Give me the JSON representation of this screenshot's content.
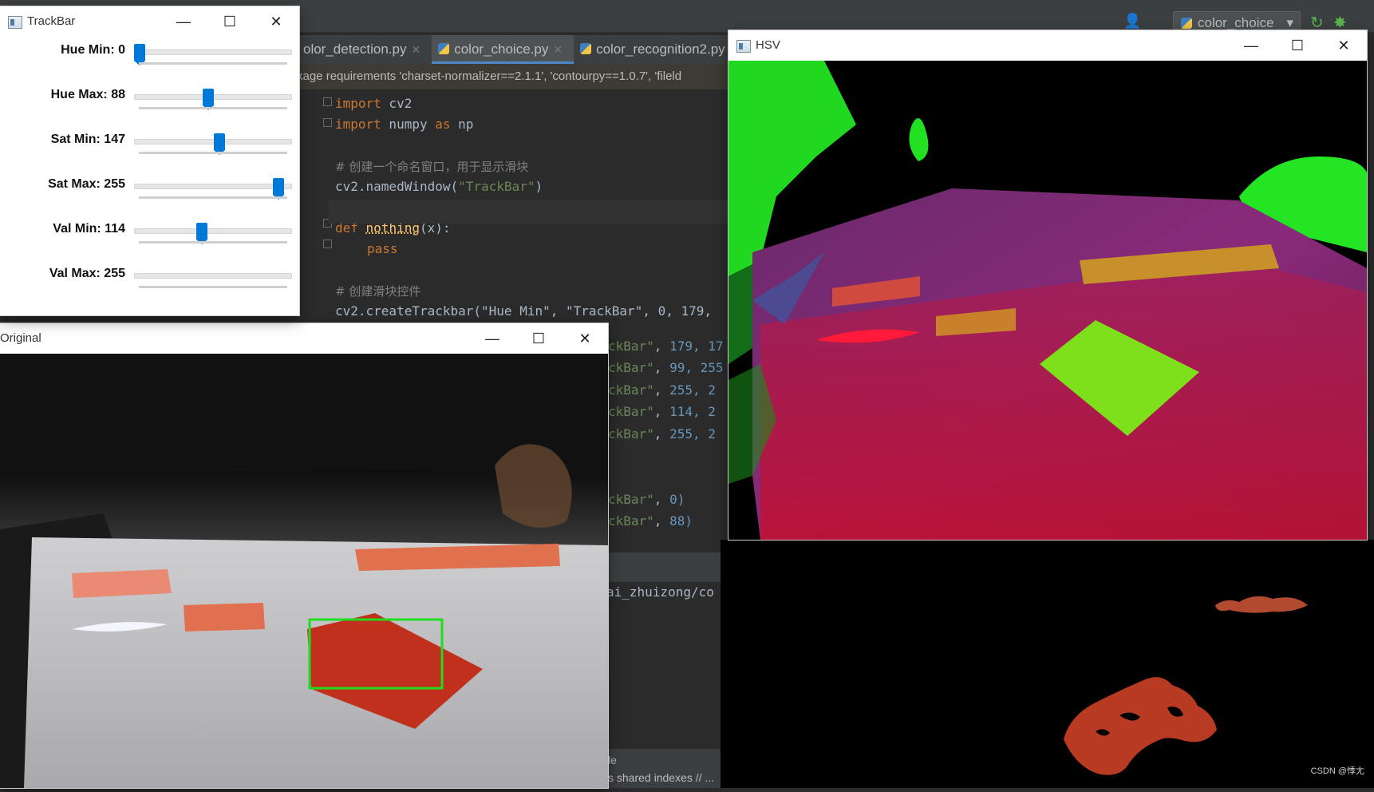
{
  "ide": {
    "tabs": [
      {
        "label": "olor_detection.py",
        "active": false
      },
      {
        "label": "color_choice.py",
        "active": true
      },
      {
        "label": "color_recognition2.py",
        "active": false
      }
    ],
    "banner": "kage requirements 'charset-normalizer==2.1.1', 'contourpy==1.0.7', 'fileld",
    "run_config": "color_choice",
    "code": {
      "l1_kw": "import",
      "l1_rest": " cv2",
      "l2_kw": "import",
      "l2_mid": " numpy ",
      "l2_as": "as",
      "l2_rest": " np",
      "l3": "# 创建一个命名窗口，用于显示滑块",
      "l4_a": "cv2.namedWindow(",
      "l4_s": "\"TrackBar\"",
      "l4_b": ")",
      "l5_kw": "def",
      "l5_fn": "nothing",
      "l5_rest": "(x):",
      "l6_kw": "pass",
      "l7": "# 创建滑块控件",
      "l8": "cv2.createTrackbar(\"Hue Min\", \"TrackBar\", 0, 179,",
      "l9_s": "ckBar\"",
      "l9_n": " 179, 17",
      "l10_s": "ckBar\"",
      "l10_n": " 99, 255",
      "l11_s": "ckBar\"",
      "l11_n": " 255, 2",
      "l12_s": "ckBar\"",
      "l12_n": " 114, 2",
      "l13_s": "ckBar\"",
      "l13_n": " 255, 2",
      "l14_s": "ckBar\"",
      "l14_n": " 0)",
      "l15_s": "ckBar\"",
      "l15_n": " 88)"
    },
    "run_path": "ai_zhuizong/co",
    "status_line1": "le",
    "status_line2": "s shared indexes // ..."
  },
  "trackbar_window": {
    "title": "TrackBar",
    "sliders": [
      {
        "label": "Hue Min: 0",
        "value": 0,
        "max": 179
      },
      {
        "label": "Hue Max: 88",
        "value": 88,
        "max": 179
      },
      {
        "label": "Sat Min: 147",
        "value": 147,
        "max": 255
      },
      {
        "label": "Sat Max: 255",
        "value": 255,
        "max": 255
      },
      {
        "label": "Val Min: 114",
        "value": 114,
        "max": 255
      },
      {
        "label": "Val Max: 255",
        "value": 255,
        "max": 255
      }
    ]
  },
  "original_window": {
    "title": "Original"
  },
  "hsv_window": {
    "title": "HSV"
  },
  "watermark": "CSDN @悸尢",
  "window_controls": {
    "minimize": "—",
    "maximize": "☐",
    "close": "✕"
  },
  "colors": {
    "accent": "#0078d7",
    "detection_box": "#1fdc1f",
    "ide_bg": "#2b2b2b"
  }
}
